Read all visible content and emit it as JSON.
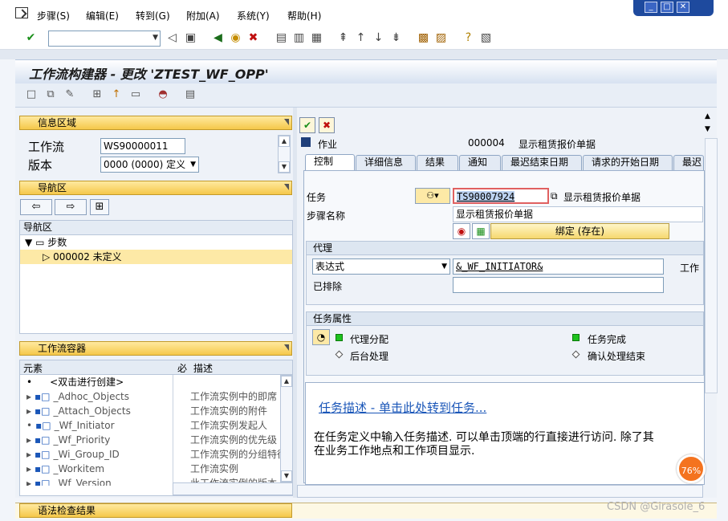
{
  "menubar": {
    "items": [
      "步骤(S)",
      "编辑(E)",
      "转到(G)",
      "附加(A)",
      "系统(Y)",
      "帮助(H)"
    ]
  },
  "window_controls": {
    "minimize": "_",
    "maximize": "□",
    "close": "✕"
  },
  "title": "工作流构建器 - 更改 'ZTEST_WF_OPP'",
  "info_panel": {
    "header": "信息区域",
    "workflow_label": "工作流",
    "workflow_value": "WS90000011",
    "version_label": "版本",
    "version_value": "0000 (0000) 定义"
  },
  "nav_panel": {
    "header": "导航区",
    "tree_header": "导航区",
    "root": "步数",
    "step": "000002 未定义"
  },
  "container_panel": {
    "header": "工作流容器",
    "col_element": "元素",
    "col_flag": "必",
    "col_desc": "描述",
    "rows": [
      {
        "name": "<双击进行创建>",
        "desc": ""
      },
      {
        "name": "_Adhoc_Objects",
        "desc": "工作流实例中的即席"
      },
      {
        "name": "_Attach_Objects",
        "desc": "工作流实例的附件"
      },
      {
        "name": "_Wf_Initiator",
        "desc": "工作流实例发起人"
      },
      {
        "name": "_Wf_Priority",
        "desc": "工作流实例的优先级"
      },
      {
        "name": "_Wi_Group_ID",
        "desc": "工作流实例的分组特征"
      },
      {
        "name": "_Workitem",
        "desc": "工作流实例"
      },
      {
        "name": "_Wf_Version",
        "desc": "此工作流实例的版本"
      }
    ]
  },
  "step_header": {
    "type_label": "作业",
    "step_number": "000004",
    "step_text": "显示租赁报价单据"
  },
  "tabs": [
    "控制",
    "详细信息",
    "结果",
    "通知",
    "最迟结束日期",
    "请求的开始日期",
    "最迟"
  ],
  "control_tab": {
    "task_label": "任务",
    "task_value": "TS90007924",
    "task_text": "显示租赁报价单据",
    "step_name_label": "步骤名称",
    "step_name_value": "显示租赁报价单据",
    "binding_button": "绑定 (存在)",
    "agent_group": "代理",
    "agent_type": "表达式",
    "agent_expression": "&_WF_INITIATOR&",
    "agent_cut_label": "工作",
    "excluded_label": "已排除",
    "task_props_group": "任务属性",
    "prop_agent_assign": "代理分配",
    "prop_background": "后台处理",
    "prop_task_complete": "任务完成",
    "prop_confirm_end": "确认处理结束",
    "description_link": "任务描述 - 单击此处转到任务...",
    "description_text_1": "在任务定义中输入任务描述. 可以单击顶端的行直接进行访问. 除了其",
    "description_text_2": "在业务工作地点和工作项目显示."
  },
  "status_bar": {
    "header": "语法检查结果"
  },
  "watermark": "CSDN @Girasole_6",
  "badge": "76%"
}
